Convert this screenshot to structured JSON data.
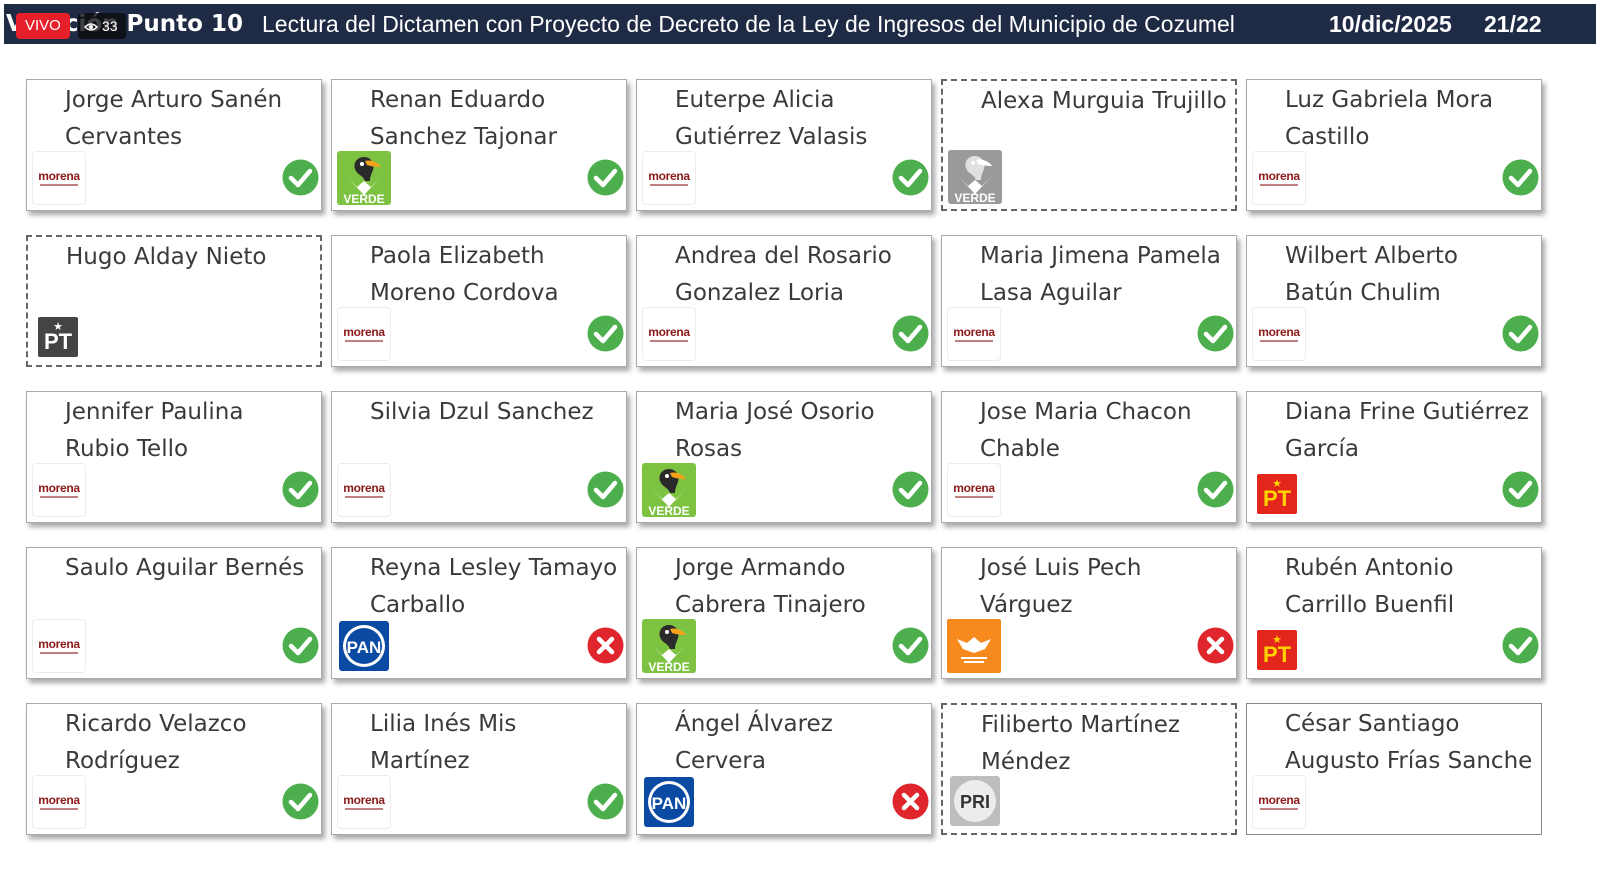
{
  "header": {
    "title_left": "Votación Punto 10",
    "live_badge": "VIVO",
    "viewer_count": "33",
    "title": "Lectura del Dictamen con Proyecto de Decreto de la Ley de Ingresos del Municipio de Cozumel",
    "date": "10/dic/2025",
    "page": "21/22"
  },
  "colors": {
    "header_bg": "#1f2a44",
    "vote_yes": "#4cae4c",
    "vote_no": "#e0262d",
    "morena": "#8b1a1a",
    "verde": "#7dc241",
    "pt": "#e3261b",
    "pan": "#0b4aa2",
    "movimiento_ciudadano": "#f68a1f"
  },
  "legislators": [
    {
      "name": "Jorge Arturo Sanén Cervantes",
      "party": "morena",
      "vote": "yes",
      "style": "normal"
    },
    {
      "name": "Renan Eduardo Sanchez Tajonar",
      "party": "verde",
      "vote": "yes",
      "style": "normal"
    },
    {
      "name": "Euterpe Alicia Gutiérrez Valasis",
      "party": "morena",
      "vote": "yes",
      "style": "normal"
    },
    {
      "name": "Alexa Murguia Trujillo",
      "party": "verde-gray",
      "vote": "none",
      "style": "dashed"
    },
    {
      "name": "Luz Gabriela Mora Castillo",
      "party": "morena",
      "vote": "yes",
      "style": "normal"
    },
    {
      "name": "Hugo Alday Nieto",
      "party": "pt-gray",
      "vote": "none",
      "style": "dashed"
    },
    {
      "name": "Paola Elizabeth Moreno Cordova",
      "party": "morena",
      "vote": "yes",
      "style": "normal"
    },
    {
      "name": "Andrea del Rosario Gonzalez Loria",
      "party": "morena",
      "vote": "yes",
      "style": "normal"
    },
    {
      "name": "Maria Jimena Pamela Lasa Aguilar",
      "party": "morena",
      "vote": "yes",
      "style": "normal"
    },
    {
      "name": "Wilbert Alberto Batún Chulim",
      "party": "morena",
      "vote": "yes",
      "style": "normal"
    },
    {
      "name": "Jennifer Paulina Rubio Tello",
      "party": "morena",
      "vote": "yes",
      "style": "normal"
    },
    {
      "name": "Silvia Dzul Sanchez",
      "party": "morena",
      "vote": "yes",
      "style": "normal"
    },
    {
      "name": "Maria José Osorio Rosas",
      "party": "verde",
      "vote": "yes",
      "style": "normal"
    },
    {
      "name": "Jose Maria Chacon Chable",
      "party": "morena",
      "vote": "yes",
      "style": "normal"
    },
    {
      "name": "Diana Frine Gutiérrez García",
      "party": "pt",
      "vote": "yes",
      "style": "normal"
    },
    {
      "name": "Saulo Aguilar Bernés",
      "party": "morena",
      "vote": "yes",
      "style": "normal"
    },
    {
      "name": "Reyna Lesley Tamayo Carballo",
      "party": "pan",
      "vote": "no",
      "style": "normal"
    },
    {
      "name": "Jorge Armando Cabrera Tinajero",
      "party": "verde",
      "vote": "yes",
      "style": "normal"
    },
    {
      "name": "José Luis Pech Várguez",
      "party": "mc",
      "vote": "no",
      "style": "normal"
    },
    {
      "name": "Rubén Antonio Carrillo Buenfil",
      "party": "pt",
      "vote": "yes",
      "style": "normal"
    },
    {
      "name": "Ricardo Velazco Rodríguez",
      "party": "morena",
      "vote": "yes",
      "style": "normal"
    },
    {
      "name": "Lilia Inés Mis Martínez",
      "party": "morena",
      "vote": "yes",
      "style": "normal"
    },
    {
      "name": "Ángel Álvarez Cervera",
      "party": "pan",
      "vote": "no",
      "style": "normal"
    },
    {
      "name": "Filiberto Martínez Méndez",
      "party": "pri-gray",
      "vote": "none",
      "style": "dashed"
    },
    {
      "name": "César Santiago Augusto Frías Sanche",
      "party": "morena",
      "vote": "none",
      "style": "noshadow"
    }
  ],
  "logos": {
    "morena": "morena",
    "verde": "VERDE",
    "pt": "PT",
    "pan": "PAN",
    "pri": "PRI"
  }
}
